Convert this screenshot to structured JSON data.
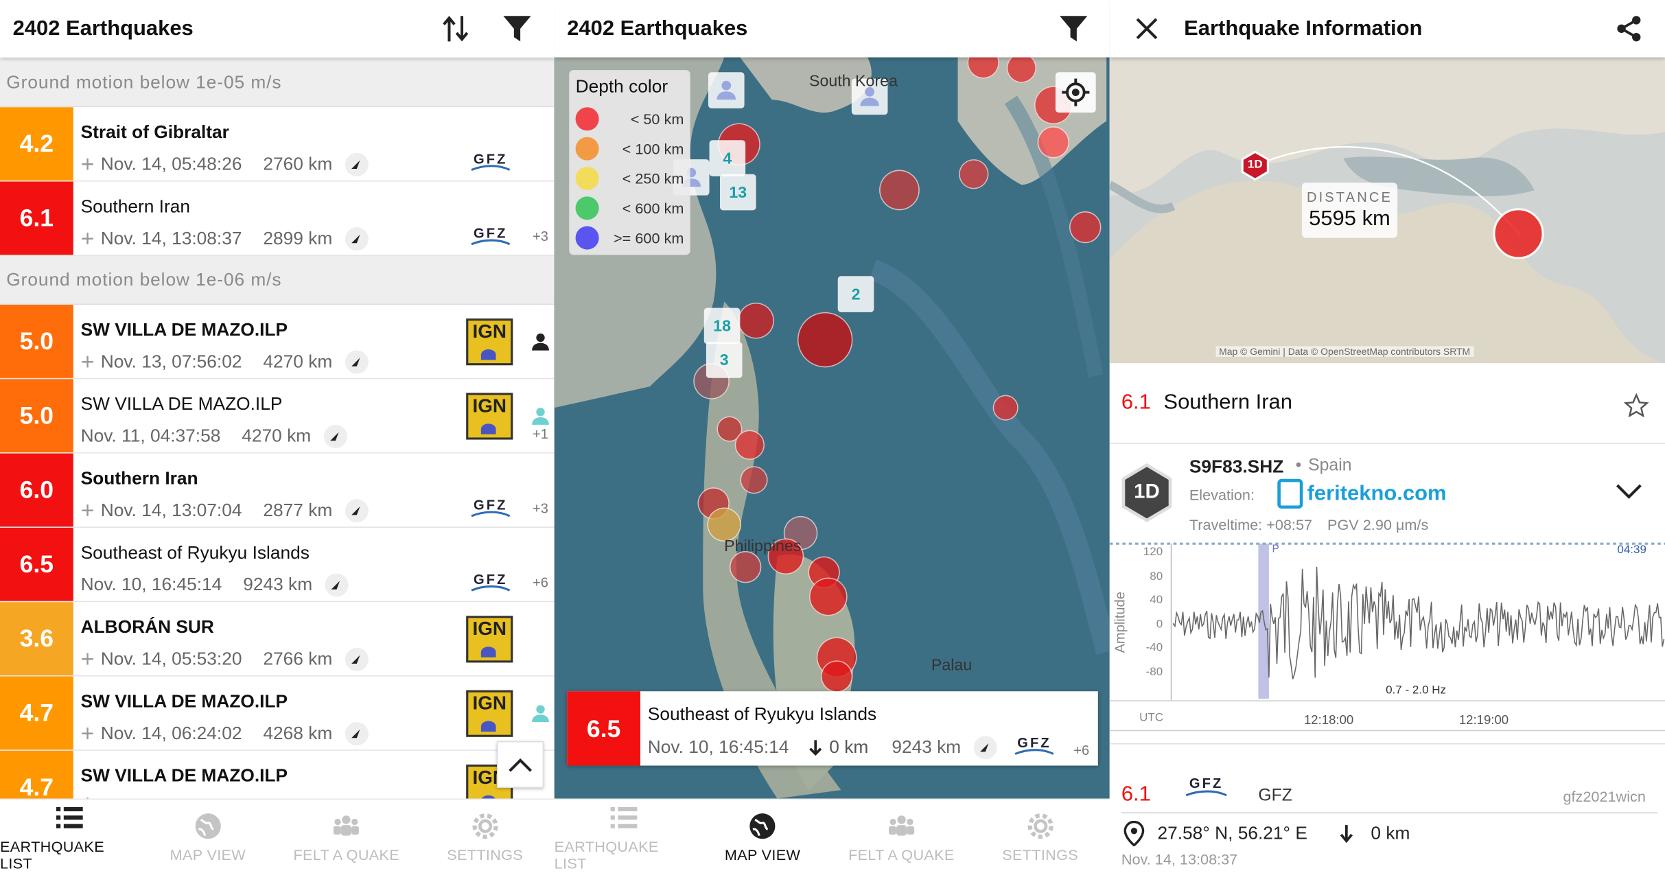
{
  "list_panel": {
    "title": "2402 Earthquakes",
    "sections": [
      {
        "header": "Ground motion below 1e-05 m/s",
        "rows": [
          {
            "mag": "4.2",
            "color": "#ff9800",
            "place": "Strait of Gibraltar",
            "bold": true,
            "plus": true,
            "time": "Nov. 14, 05:48:26",
            "dist": "2760 km",
            "agency": "GFZ",
            "extra": ""
          },
          {
            "mag": "6.1",
            "color": "#f21010",
            "place": "Southern Iran",
            "bold": false,
            "plus": true,
            "time": "Nov. 14, 13:08:37",
            "dist": "2899 km",
            "agency": "GFZ",
            "extra": "+3"
          }
        ]
      },
      {
        "header": "Ground motion below 1e-06 m/s",
        "rows": [
          {
            "mag": "5.0",
            "color": "#ff6d0a",
            "place": "SW VILLA DE MAZO.ILP",
            "bold": true,
            "plus": true,
            "time": "Nov. 13, 07:56:02",
            "dist": "4270 km",
            "agency": "IGN",
            "extra": ""
          },
          {
            "mag": "5.0",
            "color": "#ff6d0a",
            "place": "SW VILLA DE MAZO.ILP",
            "bold": false,
            "plus": false,
            "time": "Nov. 11, 04:37:58",
            "dist": "4270 km",
            "agency": "IGN",
            "extra": "+1"
          },
          {
            "mag": "6.0",
            "color": "#f21010",
            "place": "Southern Iran",
            "bold": true,
            "plus": true,
            "time": "Nov. 14, 13:07:04",
            "dist": "2877 km",
            "agency": "GFZ",
            "extra": "+3"
          },
          {
            "mag": "6.5",
            "color": "#f21010",
            "place": "Southeast of Ryukyu Islands",
            "bold": false,
            "plus": false,
            "time": "Nov. 10, 16:45:14",
            "dist": "9243 km",
            "agency": "GFZ",
            "extra": "+6"
          },
          {
            "mag": "3.6",
            "color": "#f5a623",
            "place": "ALBORÁN SUR",
            "bold": true,
            "plus": true,
            "time": "Nov. 14, 05:53:20",
            "dist": "2766 km",
            "agency": "IGN",
            "extra": ""
          },
          {
            "mag": "4.7",
            "color": "#ff9800",
            "place": "SW VILLA DE MAZO.ILP",
            "bold": true,
            "plus": true,
            "time": "Nov. 14, 06:24:02",
            "dist": "4268 km",
            "agency": "IGN",
            "extra": ""
          },
          {
            "mag": "4.7",
            "color": "#ff9800",
            "place": "SW VILLA DE MAZO.ILP",
            "bold": true,
            "plus": true,
            "time": "",
            "dist": "",
            "agency": "IGN",
            "extra": ""
          }
        ]
      }
    ]
  },
  "map_panel": {
    "title": "2402 Earthquakes",
    "legend_title": "Depth color",
    "legend": [
      {
        "label": "< 50 km",
        "color": "#f0444a"
      },
      {
        "label": "< 100 km",
        "color": "#f39a44"
      },
      {
        "label": "< 250 km",
        "color": "#f3dc5a"
      },
      {
        "label": "< 600 km",
        "color": "#4cc96a"
      },
      {
        "label": ">= 600 km",
        "color": "#5a55f0"
      }
    ],
    "labels": [
      "South Korea",
      "Philippines",
      "Palau"
    ],
    "clusters": [
      "4",
      "13",
      "2",
      "18",
      "3"
    ],
    "popup": {
      "mag": "6.5",
      "place": "Southeast of Ryukyu Islands",
      "time": "Nov. 10, 16:45:14",
      "depth": "0 km",
      "dist": "9243 km",
      "agency": "GFZ",
      "extra": "+6"
    }
  },
  "nav": {
    "items": [
      "EARTHQUAKE LIST",
      "MAP VIEW",
      "FELT A QUAKE",
      "SETTINGS"
    ]
  },
  "info_panel": {
    "title": "Earthquake Information",
    "distance_label": "DISTANCE",
    "distance_value": "5595 km",
    "station_marker": "1D",
    "attribution": "Map © Gemini | Data © OpenStreetMap contributors SRTM",
    "event_mag": "6.1",
    "event_place": "Southern Iran",
    "station_code": "S9F83.SHZ",
    "station_country": "Spain",
    "elevation_label": "Elevation:",
    "watermark": "feritekno.com",
    "traveltime": "Traveltime: +08:57",
    "pgv": "PGV 2.90 μm/s",
    "y_label": "Amplitude",
    "y_ticks": [
      "120",
      "80",
      "40",
      "0",
      "-40",
      "-80"
    ],
    "x_ticks": [
      "12:18:00",
      "12:19:00"
    ],
    "utc_label": "UTC",
    "phase_label": "P",
    "time_label": "04:39",
    "filter_label": "0.7 - 2.0 Hz",
    "source_mag": "6.1",
    "source_agency": "GFZ",
    "source_id": "gfz2021wicn",
    "coords": "27.58° N, 56.21° E",
    "depth": "0 km",
    "datetime": "Nov. 14, 13:08:37"
  },
  "colors": {
    "red": "#f21010",
    "accent": "#1a9fd8"
  }
}
